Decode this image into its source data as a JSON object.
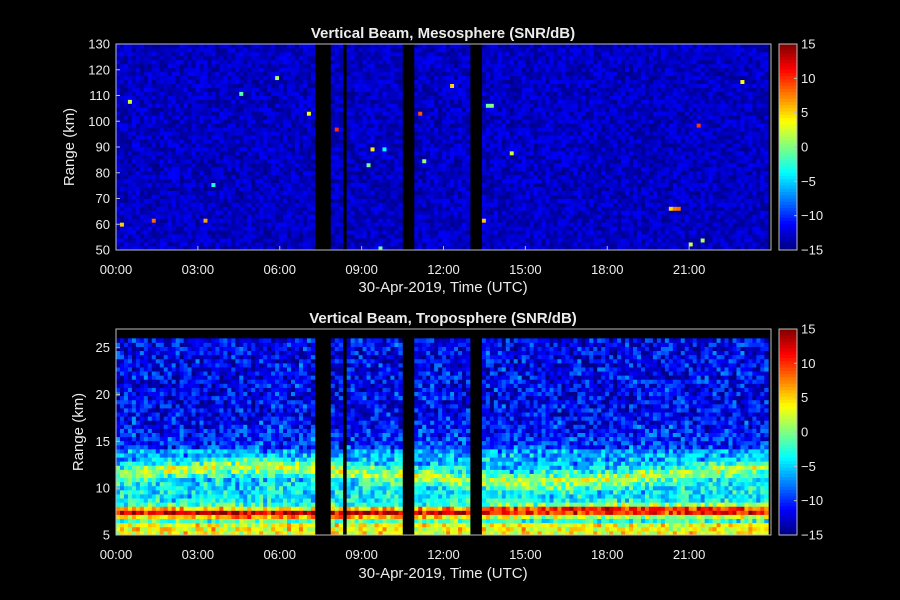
{
  "chart_data": [
    {
      "type": "heatmap",
      "title": "Vertical Beam, Mesosphere (SNR/dB)",
      "xlabel": "30-Apr-2019, Time (UTC)",
      "ylabel": "Range (km)",
      "xlim_hours": [
        0,
        24
      ],
      "ylim": [
        50,
        130
      ],
      "data_top_km": 130,
      "xticks": [
        "00:00",
        "03:00",
        "06:00",
        "09:00",
        "12:00",
        "15:00",
        "18:00",
        "21:00"
      ],
      "yticks": [
        50,
        60,
        70,
        80,
        90,
        100,
        110,
        120,
        130
      ],
      "colorbar": {
        "min": -15,
        "max": 15,
        "ticks": [
          15,
          10,
          5,
          0,
          -5,
          -10,
          -15
        ],
        "colormap": "jet"
      },
      "data_gaps_hours": [
        [
          7.25,
          7.8
        ],
        [
          8.3,
          8.5
        ],
        [
          8.7,
          8.8
        ],
        [
          10.5,
          11.0
        ],
        [
          12.9,
          13.4
        ]
      ],
      "data_end_hours": 23.9,
      "background_snr_db": -13,
      "signal": "sparse weak echoes, mostly noise"
    },
    {
      "type": "heatmap",
      "title": "Vertical Beam, Troposphere (SNR/dB)",
      "xlabel": "30-Apr-2019, Time (UTC)",
      "ylabel": "Range (km)",
      "xlim_hours": [
        0,
        24
      ],
      "ylim": [
        5,
        27
      ],
      "data_top_km": 26,
      "xticks": [
        "00:00",
        "03:00",
        "06:00",
        "09:00",
        "12:00",
        "15:00",
        "18:00",
        "21:00"
      ],
      "yticks": [
        5,
        10,
        15,
        20,
        25
      ],
      "colorbar": {
        "min": -15,
        "max": 15,
        "ticks": [
          15,
          10,
          5,
          0,
          -5,
          -10,
          -15
        ],
        "colormap": "jet"
      },
      "data_gaps_hours": [
        [
          7.25,
          7.8
        ],
        [
          8.3,
          8.5
        ],
        [
          8.7,
          8.8
        ],
        [
          10.5,
          11.0
        ],
        [
          12.9,
          13.4
        ]
      ],
      "data_end_hours": 23.9,
      "signal": "strong echoes below ~13 km, peak near 6-8 km"
    }
  ]
}
